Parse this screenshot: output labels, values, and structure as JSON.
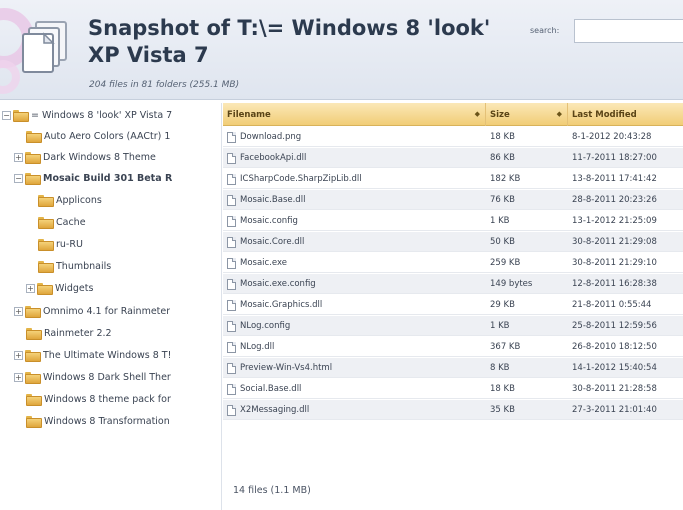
{
  "header": {
    "title": "Snapshot of T:\\= Windows 8 'look' XP Vista 7",
    "subtitle": "204 files in 81 folders (255.1 MB)",
    "search_label": "search:",
    "search_value": ""
  },
  "tree": {
    "items": [
      {
        "label": "= Windows 8 'look' XP Vista 7",
        "toggle": "−",
        "bold": false
      },
      {
        "label": "Auto Aero Colors (AACtr) 1",
        "toggle": "",
        "bold": false
      },
      {
        "label": "Dark Windows 8 Theme",
        "toggle": "+",
        "bold": false
      },
      {
        "label": "Mosaic Build 301 Beta R",
        "toggle": "−",
        "bold": true
      },
      {
        "label": "Applicons",
        "toggle": "",
        "bold": false
      },
      {
        "label": "Cache",
        "toggle": "",
        "bold": false
      },
      {
        "label": "ru-RU",
        "toggle": "",
        "bold": false
      },
      {
        "label": "Thumbnails",
        "toggle": "",
        "bold": false
      },
      {
        "label": "Widgets",
        "toggle": "+",
        "bold": false
      },
      {
        "label": "Omnimo 4.1 for Rainmeter",
        "toggle": "+",
        "bold": false
      },
      {
        "label": "Rainmeter 2.2",
        "toggle": "",
        "bold": false
      },
      {
        "label": "The Ultimate Windows 8 T!",
        "toggle": "+",
        "bold": false
      },
      {
        "label": "Windows 8 Dark Shell Ther",
        "toggle": "+",
        "bold": false
      },
      {
        "label": "Windows 8 theme pack for",
        "toggle": "",
        "bold": false
      },
      {
        "label": "Windows 8 Transformation",
        "toggle": "",
        "bold": false
      }
    ]
  },
  "grid": {
    "columns": [
      "Filename",
      "Size",
      "Last Modified"
    ],
    "rows": [
      {
        "name": "Download.png",
        "size": "18 KB",
        "modified": "8-1-2012 20:43:28"
      },
      {
        "name": "FacebookApi.dll",
        "size": "86 KB",
        "modified": "11-7-2011 18:27:00"
      },
      {
        "name": "ICSharpCode.SharpZipLib.dll",
        "size": "182 KB",
        "modified": "13-8-2011 17:41:42"
      },
      {
        "name": "Mosaic.Base.dll",
        "size": "76 KB",
        "modified": "28-8-2011 20:23:26"
      },
      {
        "name": "Mosaic.config",
        "size": "1 KB",
        "modified": "13-1-2012 21:25:09"
      },
      {
        "name": "Mosaic.Core.dll",
        "size": "50 KB",
        "modified": "30-8-2011 21:29:08"
      },
      {
        "name": "Mosaic.exe",
        "size": "259 KB",
        "modified": "30-8-2011 21:29:10"
      },
      {
        "name": "Mosaic.exe.config",
        "size": "149 bytes",
        "modified": "12-8-2011 16:28:38"
      },
      {
        "name": "Mosaic.Graphics.dll",
        "size": "29 KB",
        "modified": "21-8-2011 0:55:44"
      },
      {
        "name": "NLog.config",
        "size": "1 KB",
        "modified": "25-8-2011 12:59:56"
      },
      {
        "name": "NLog.dll",
        "size": "367 KB",
        "modified": "26-8-2010 18:12:50"
      },
      {
        "name": "Preview-Win-Vs4.html",
        "size": "8 KB",
        "modified": "14-1-2012 15:40:54"
      },
      {
        "name": "Social.Base.dll",
        "size": "18 KB",
        "modified": "30-8-2011 21:28:58"
      },
      {
        "name": "X2Messaging.dll",
        "size": "35 KB",
        "modified": "27-3-2011 21:01:40"
      }
    ],
    "footer": "14 files (1.1 MB)"
  }
}
